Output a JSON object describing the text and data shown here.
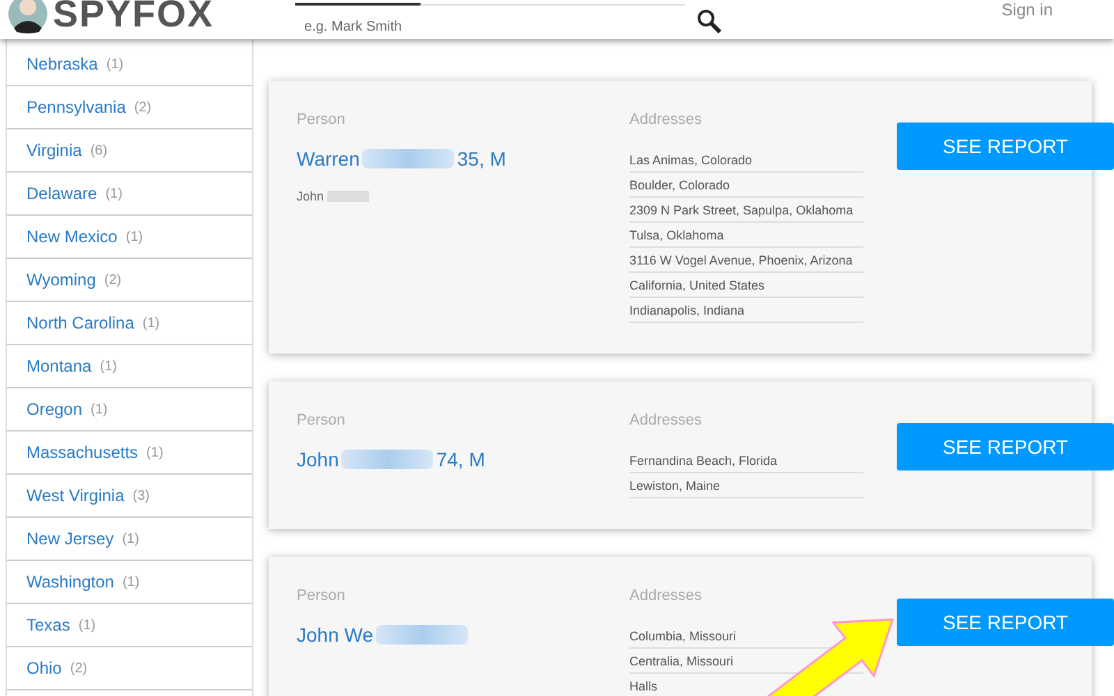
{
  "header": {
    "logo": "SPYFOX",
    "search": {
      "placeholder": "e.g. Mark Smith"
    },
    "sign_in": "Sign in"
  },
  "states": [
    {
      "name": "Nebraska",
      "count": "(1)"
    },
    {
      "name": "Pennsylvania",
      "count": "(2)"
    },
    {
      "name": "Virginia",
      "count": "(6)"
    },
    {
      "name": "Delaware",
      "count": "(1)"
    },
    {
      "name": "New Mexico",
      "count": "(1)"
    },
    {
      "name": "Wyoming",
      "count": "(2)"
    },
    {
      "name": "North Carolina",
      "count": "(1)"
    },
    {
      "name": "Montana",
      "count": "(1)"
    },
    {
      "name": "Oregon",
      "count": "(1)"
    },
    {
      "name": "Massachusetts",
      "count": "(1)"
    },
    {
      "name": "West Virginia",
      "count": "(3)"
    },
    {
      "name": "New Jersey",
      "count": "(1)"
    },
    {
      "name": "Washington",
      "count": "(1)"
    },
    {
      "name": "Texas",
      "count": "(1)"
    },
    {
      "name": "Ohio",
      "count": "(2)"
    }
  ],
  "results": [
    {
      "person_label": "Person",
      "name": "Warren",
      "age": "35, M",
      "relative": "John",
      "addresses_label": "Addresses",
      "addresses": [
        "Las Animas, Colorado",
        "Boulder, Colorado",
        "2309 N Park Street, Sapulpa, Oklahoma",
        "Tulsa, Oklahoma",
        "3116 W Vogel Avenue, Phoenix, Arizona",
        "California, United States",
        "Indianapolis, Indiana"
      ],
      "button": "SEE REPORT"
    },
    {
      "person_label": "Person",
      "name": "John",
      "age": "74, M",
      "addresses_label": "Addresses",
      "addresses": [
        "Fernandina Beach, Florida",
        "Lewiston, Maine"
      ],
      "button": "SEE REPORT"
    },
    {
      "person_label": "Person",
      "name": "John We",
      "addresses_label": "Addresses",
      "addresses": [
        "Columbia, Missouri",
        "Centralia, Missouri",
        "Halls"
      ],
      "button": "SEE REPORT",
      "highlighted": true
    }
  ]
}
